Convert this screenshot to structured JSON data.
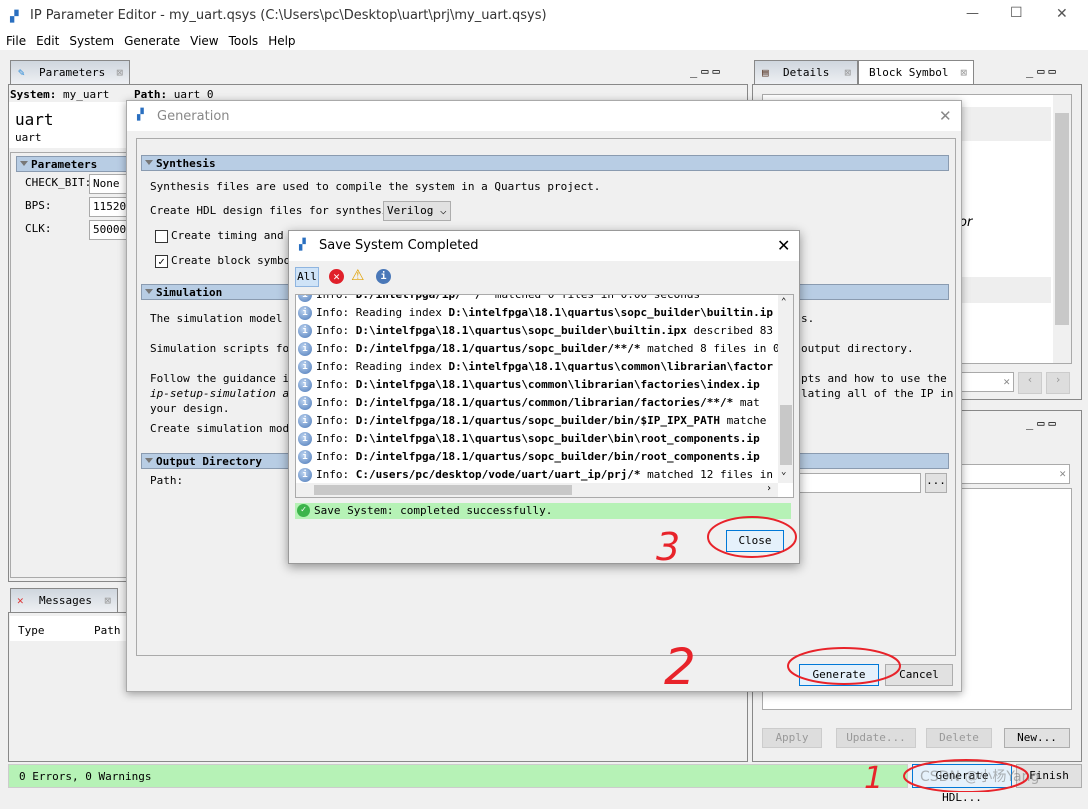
{
  "window": {
    "title": "IP Parameter Editor - my_uart.qsys (C:\\Users\\pc\\Desktop\\uart\\prj\\my_uart.qsys)",
    "minimize": "—",
    "maximize": "☐",
    "close": "✕"
  },
  "menu": [
    "File",
    "Edit",
    "System",
    "Generate",
    "View",
    "Tools",
    "Help"
  ],
  "parameters_panel": {
    "tab": "Parameters",
    "system_label": "System:",
    "system_value": "my_uart",
    "path_label": "Path:",
    "path_value": "uart_0",
    "component_title": "uart",
    "component_sub": "uart",
    "section": "Parameters",
    "rows": [
      {
        "label": "CHECK_BIT:",
        "value": "None"
      },
      {
        "label": "BPS:",
        "value": "115200"
      },
      {
        "label": "CLK:",
        "value": "50000000"
      }
    ]
  },
  "messages_panel": {
    "tab": "Messages",
    "columns": [
      "Type",
      "Path"
    ]
  },
  "details_panel": {
    "tabs": [
      "Details",
      "Block Symbol"
    ],
    "partial_text": "or"
  },
  "right_buttons": {
    "apply": "Apply",
    "update": "Update...",
    "delete": "Delete",
    "new": "New..."
  },
  "status": {
    "text": "0 Errors, 0 Warnings",
    "generate_hdl": "Generate HDL...",
    "finish": "Finish"
  },
  "generation_dialog": {
    "title": "Generation",
    "synthesis": {
      "header": "Synthesis",
      "desc": "Synthesis files are used to compile the system in a Quartus project.",
      "hdl_label": "Create HDL design files for synthesis:",
      "hdl_value": "Verilog",
      "timing_label": "Create timing and re",
      "timing_checked": false,
      "block_label": "Create block symbol",
      "block_checked": true
    },
    "simulation": {
      "header": "Simulation",
      "line1_left": "The simulation model co",
      "line1_right": "s.",
      "line2_left": "Simulation scripts for",
      "line2_right": "output directory.",
      "line3_left": "Follow the guidance in",
      "line3_right": "pts and how to use the",
      "line4_left": "ip-setup-simulation and",
      "line4_right": "lating all of the IP in",
      "line5": "your design.",
      "line6": "Create simulation model"
    },
    "output": {
      "header": "Output Directory",
      "path_label": "Path:",
      "browse": "..."
    },
    "generate": "Generate",
    "cancel": "Cancel"
  },
  "save_dialog": {
    "title": "Save System Completed",
    "filter_all": "All",
    "filters": [
      "error-icon",
      "warning-icon",
      "info-icon"
    ],
    "log": [
      {
        "pre": "Info: ",
        "plain1": "",
        "bold": "D:/intelfpga/ip/**/*",
        "plain2": " matched 0 files in 0.00 seconds"
      },
      {
        "pre": "Info: ",
        "plain1": "Reading index ",
        "bold": "D:\\intelfpga\\18.1\\quartus\\sopc_builder\\builtin.ip",
        "plain2": ""
      },
      {
        "pre": "Info: ",
        "plain1": "",
        "bold": "D:\\intelfpga\\18.1\\quartus\\sopc_builder\\builtin.ipx",
        "plain2": " described 83"
      },
      {
        "pre": "Info: ",
        "plain1": "",
        "bold": "D:/intelfpga/18.1/quartus/sopc_builder/**/*",
        "plain2": " matched 8 files in 0"
      },
      {
        "pre": "Info: ",
        "plain1": "Reading index ",
        "bold": "D:\\intelfpga\\18.1\\quartus\\common\\librarian\\factor",
        "plain2": ""
      },
      {
        "pre": "Info: ",
        "plain1": "",
        "bold": "D:\\intelfpga\\18.1\\quartus\\common\\librarian\\factories\\index.ip",
        "plain2": ""
      },
      {
        "pre": "Info: ",
        "plain1": "",
        "bold": "D:/intelfpga/18.1/quartus/common/librarian/factories/**/*",
        "plain2": " mat"
      },
      {
        "pre": "Info: ",
        "plain1": "",
        "bold": "D:/intelfpga/18.1/quartus/sopc_builder/bin/$IP_IPX_PATH",
        "plain2": " matche"
      },
      {
        "pre": "Info: ",
        "plain1": "",
        "bold": "D:\\intelfpga\\18.1\\quartus\\sopc_builder\\bin\\root_components.ip",
        "plain2": ""
      },
      {
        "pre": "Info: ",
        "plain1": "",
        "bold": "D:/intelfpga/18.1/quartus/sopc_builder/bin/root_components.ip",
        "plain2": ""
      },
      {
        "pre": "Info: ",
        "plain1": "",
        "bold": "C:/users/pc/desktop/vode/uart/uart_ip/prj/*",
        "plain2": " matched 12 files in"
      }
    ],
    "success": "Save System: completed successfully.",
    "close": "Close"
  },
  "annotations": {
    "color": "#e8232a",
    "marks": [
      "1",
      "2",
      "3"
    ]
  },
  "watermark": "CSDN @小杨Yang",
  "colors": {
    "section_header": "#b8cde4",
    "status_green": "#b6f2b6",
    "success_green": "#b6f2b6",
    "focus_blue": "#0078d7"
  }
}
